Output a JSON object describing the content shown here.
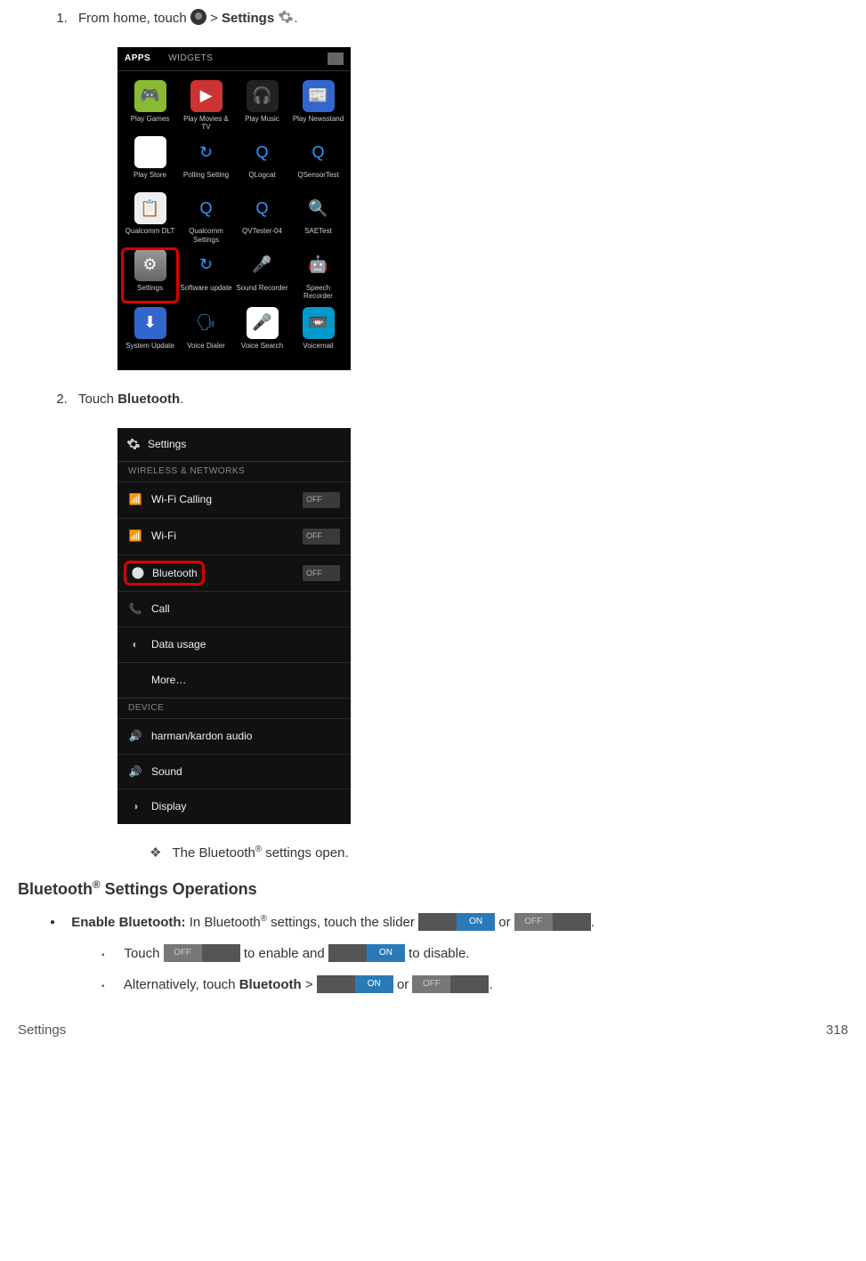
{
  "step1": {
    "prefix": "From home, touch ",
    "gt": " > ",
    "settings": "Settings",
    "period": "."
  },
  "apps_shot": {
    "tab1": "APPS",
    "tab2": "WIDGETS",
    "apps": [
      {
        "label": "Play Games"
      },
      {
        "label": "Play Movies & TV"
      },
      {
        "label": "Play Music"
      },
      {
        "label": "Play Newsstand"
      },
      {
        "label": "Play Store"
      },
      {
        "label": "Polling Setting"
      },
      {
        "label": "QLogcat"
      },
      {
        "label": "QSensorTest"
      },
      {
        "label": "Qualcomm DLT"
      },
      {
        "label": "Qualcomm Settings"
      },
      {
        "label": "QVTester-04"
      },
      {
        "label": "SAETest"
      },
      {
        "label": "Settings"
      },
      {
        "label": "Software update"
      },
      {
        "label": "Sound Recorder"
      },
      {
        "label": "Speech Recorder"
      },
      {
        "label": "System Update"
      },
      {
        "label": "Voice Dialer"
      },
      {
        "label": "Voice Search"
      },
      {
        "label": "Voicemail"
      }
    ]
  },
  "step2": {
    "prefix": "Touch ",
    "bt": "Bluetooth",
    "period": "."
  },
  "settings_shot": {
    "title": "Settings",
    "section1": "WIRELESS & NETWORKS",
    "rows1": [
      {
        "icon": "📶",
        "label": "Wi-Fi Calling",
        "tog": "OFF"
      },
      {
        "icon": "📶",
        "label": "Wi-Fi",
        "tog": "OFF"
      },
      {
        "icon": "⚪",
        "label": "Bluetooth",
        "tog": "OFF",
        "hl": true
      },
      {
        "icon": "📞",
        "label": "Call"
      },
      {
        "icon": "◐",
        "label": "Data usage"
      },
      {
        "icon": "",
        "label": "More…"
      }
    ],
    "section2": "DEVICE",
    "rows2": [
      {
        "icon": "🔊",
        "label": "harman/kardon audio"
      },
      {
        "icon": "🔊",
        "label": "Sound"
      },
      {
        "icon": "◑",
        "label": "Display"
      }
    ]
  },
  "note": {
    "t1": "The Bluetooth",
    "t2": " settings open."
  },
  "heading": {
    "t1": "Bluetooth",
    "t2": " Settings Operations"
  },
  "bullet1": {
    "b": "Enable Bluetooth:",
    "t1": " In Bluetooth",
    "t2": " settings, touch the slider ",
    "or": " or ",
    "period": "."
  },
  "sq1": {
    "t1": "Touch ",
    "t2": " to enable and ",
    "t3": " to disable."
  },
  "sq2": {
    "t1": "Alternatively, touch ",
    "bt": "Bluetooth",
    "gt": " > ",
    "or": " or ",
    "period": "."
  },
  "tog": {
    "on": "ON",
    "off": "OFF"
  },
  "footer": {
    "left": "Settings",
    "right": "318"
  }
}
